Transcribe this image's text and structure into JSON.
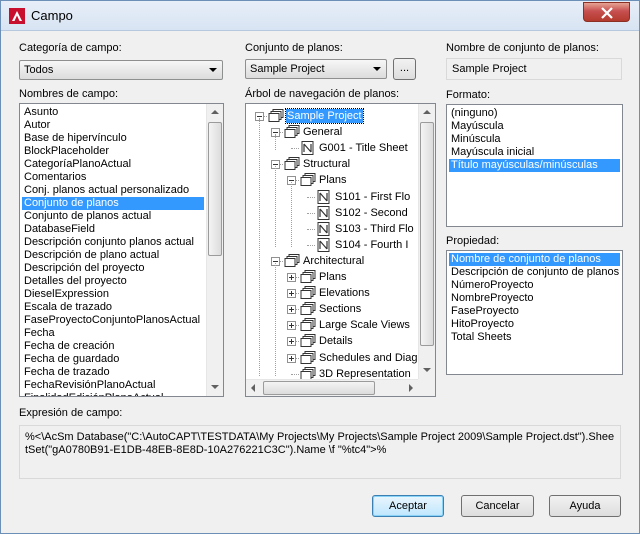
{
  "window": {
    "title": "Campo",
    "close_label": "×"
  },
  "category": {
    "label": "Categoría de campo:",
    "selected": "Todos"
  },
  "field_names": {
    "label": "Nombres de campo:",
    "items": [
      "Asunto",
      "Autor",
      "Base de hipervínculo",
      "BlockPlaceholder",
      "CategoríaPlanoActual",
      "Comentarios",
      "Conj. planos actual personalizado",
      "Conjunto de planos",
      "Conjunto de planos actual",
      "DatabaseField",
      "Descripción conjunto planos actual",
      "Descripción de plano actual",
      "Descripción del proyecto",
      "Detalles del proyecto",
      "DieselExpression",
      "Escala de trazado",
      "FaseProyectoConjuntoPlanosActual",
      "Fecha",
      "Fecha de creación",
      "Fecha de guardado",
      "Fecha de trazado",
      "FechaRevisiónPlanoActual"
    ],
    "selected_index": 7,
    "partial_item": "FinalidadEdiciónPlanoActual"
  },
  "sheet_set": {
    "label": "Conjunto de planos:",
    "selected": "Sample Project",
    "browse_label": "..."
  },
  "sheet_set_name": {
    "label": "Nombre de conjunto de planos:",
    "value": "Sample Project"
  },
  "tree": {
    "label": "Árbol de navegación de planos:",
    "nodes": [
      {
        "label": "Sample Project",
        "icon": "sheet-set-icon",
        "expander": "minus",
        "selected": true
      },
      {
        "label": "General",
        "icon": "subset-icon",
        "expander": "minus"
      },
      {
        "label": "G001 - Title Sheet",
        "icon": "sheet-icon"
      },
      {
        "label": "Structural",
        "icon": "subset-icon",
        "expander": "minus"
      },
      {
        "label": "Plans",
        "icon": "subset-icon",
        "expander": "minus"
      },
      {
        "label": "S101 - First Flo",
        "icon": "sheet-icon"
      },
      {
        "label": "S102 - Second",
        "icon": "sheet-icon"
      },
      {
        "label": "S103 - Third Flo",
        "icon": "sheet-icon"
      },
      {
        "label": "S104 - Fourth I",
        "icon": "sheet-icon"
      },
      {
        "label": "Architectural",
        "icon": "subset-icon",
        "expander": "minus"
      },
      {
        "label": "Plans",
        "icon": "subset-icon",
        "expander": "plus"
      },
      {
        "label": "Elevations",
        "icon": "subset-icon",
        "expander": "plus"
      },
      {
        "label": "Sections",
        "icon": "subset-icon",
        "expander": "plus"
      },
      {
        "label": "Large Scale Views",
        "icon": "subset-icon",
        "expander": "plus"
      },
      {
        "label": "Details",
        "icon": "subset-icon",
        "expander": "plus"
      },
      {
        "label": "Schedules and Diag",
        "icon": "subset-icon",
        "expander": "plus"
      },
      {
        "label": "3D Representation",
        "icon": "subset-icon"
      }
    ]
  },
  "format": {
    "label": "Formato:",
    "items": [
      "(ninguno)",
      "Mayúscula",
      "Minúscula",
      "Mayúscula inicial",
      "Título mayúsculas/minúsculas"
    ],
    "selected_index": 4
  },
  "property": {
    "label": "Propiedad:",
    "items": [
      "Nombre de conjunto de planos",
      "Descripción de conjunto de planos",
      "NúmeroProyecto",
      "NombreProyecto",
      "FaseProyecto",
      "HitoProyecto",
      "Total Sheets"
    ],
    "selected_index": 0
  },
  "expression": {
    "label": "Expresión de campo:",
    "value": "%<\\AcSm Database(\"C:\\AutoCAPT\\TESTDATA\\My Projects\\My Projects\\Sample Project 2009\\Sample Project.dst\").SheetSet(\"gA0780B91-E1DB-48EB-8E8D-10A276221C3C\").Name \\f \"%tc4\">%"
  },
  "buttons": {
    "ok": "Aceptar",
    "cancel": "Cancelar",
    "help": "Ayuda"
  },
  "colors": {
    "selection": "#3399ff",
    "close_button": "#c75050",
    "default_button_border": "#3c7fb1"
  }
}
